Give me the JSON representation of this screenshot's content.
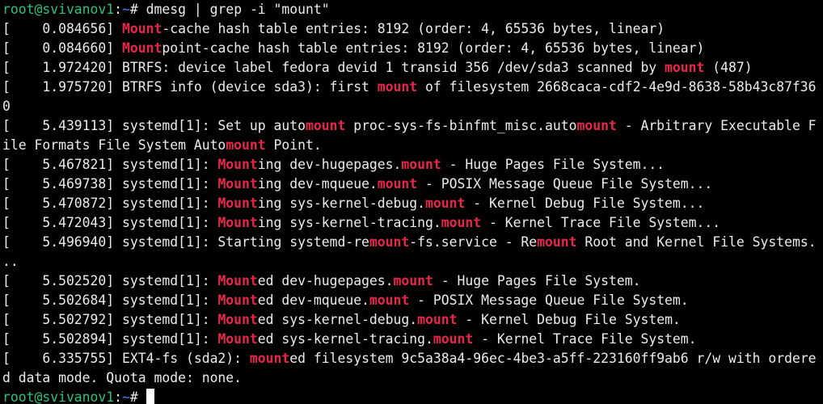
{
  "prompt": {
    "user_host": "root@svivanov1",
    "colon": ":",
    "path": "~",
    "symbol": "# "
  },
  "command": "dmesg | grep -i \"mount\"",
  "colors": {
    "background": "#000000",
    "text": "#ececec",
    "match_highlight": "#e8264a",
    "prompt_user": "#2ec27e",
    "prompt_path": "#3f83e8"
  },
  "highlight_term": "mount",
  "output_lines": [
    [
      [
        "t",
        "[    0.084656] "
      ],
      [
        "h",
        "Mount"
      ],
      [
        "t",
        "-cache hash table entries: 8192 (order: 4, 65536 bytes, linear)"
      ]
    ],
    [
      [
        "t",
        "[    0.084660] "
      ],
      [
        "h",
        "Mount"
      ],
      [
        "t",
        "point-cache hash table entries: 8192 (order: 4, 65536 bytes, linear)"
      ]
    ],
    [
      [
        "t",
        "[    1.972420] BTRFS: device label fedora devid 1 transid 356 /dev/sda3 scanned by "
      ],
      [
        "h",
        "mount"
      ],
      [
        "t",
        " (487)"
      ]
    ],
    [
      [
        "t",
        "[    1.975720] BTRFS info (device sda3): first "
      ],
      [
        "h",
        "mount"
      ],
      [
        "t",
        " of filesystem 2668caca-cdf2-4e9d-8638-58b43c87f36"
      ]
    ],
    [
      [
        "t",
        "0"
      ]
    ],
    [
      [
        "t",
        "[    5.439113] systemd[1]: Set up auto"
      ],
      [
        "h",
        "mount"
      ],
      [
        "t",
        " proc-sys-fs-binfmt_misc.auto"
      ],
      [
        "h",
        "mount"
      ],
      [
        "t",
        " - Arbitrary Executable F"
      ]
    ],
    [
      [
        "t",
        "ile Formats File System Auto"
      ],
      [
        "h",
        "mount"
      ],
      [
        "t",
        " Point."
      ]
    ],
    [
      [
        "t",
        "[    5.467821] systemd[1]: "
      ],
      [
        "h",
        "Mount"
      ],
      [
        "t",
        "ing dev-hugepages."
      ],
      [
        "h",
        "mount"
      ],
      [
        "t",
        " - Huge Pages File System..."
      ]
    ],
    [
      [
        "t",
        "[    5.469738] systemd[1]: "
      ],
      [
        "h",
        "Mount"
      ],
      [
        "t",
        "ing dev-mqueue."
      ],
      [
        "h",
        "mount"
      ],
      [
        "t",
        " - POSIX Message Queue File System..."
      ]
    ],
    [
      [
        "t",
        "[    5.470872] systemd[1]: "
      ],
      [
        "h",
        "Mount"
      ],
      [
        "t",
        "ing sys-kernel-debug."
      ],
      [
        "h",
        "mount"
      ],
      [
        "t",
        " - Kernel Debug File System..."
      ]
    ],
    [
      [
        "t",
        "[    5.472043] systemd[1]: "
      ],
      [
        "h",
        "Mount"
      ],
      [
        "t",
        "ing sys-kernel-tracing."
      ],
      [
        "h",
        "mount"
      ],
      [
        "t",
        " - Kernel Trace File System..."
      ]
    ],
    [
      [
        "t",
        "[    5.496940] systemd[1]: Starting systemd-re"
      ],
      [
        "h",
        "mount"
      ],
      [
        "t",
        "-fs.service - Re"
      ],
      [
        "h",
        "mount"
      ],
      [
        "t",
        " Root and Kernel File Systems."
      ]
    ],
    [
      [
        "t",
        ".."
      ]
    ],
    [
      [
        "t",
        "[    5.502520] systemd[1]: "
      ],
      [
        "h",
        "Mount"
      ],
      [
        "t",
        "ed dev-hugepages."
      ],
      [
        "h",
        "mount"
      ],
      [
        "t",
        " - Huge Pages File System."
      ]
    ],
    [
      [
        "t",
        "[    5.502684] systemd[1]: "
      ],
      [
        "h",
        "Mount"
      ],
      [
        "t",
        "ed dev-mqueue."
      ],
      [
        "h",
        "mount"
      ],
      [
        "t",
        " - POSIX Message Queue File System."
      ]
    ],
    [
      [
        "t",
        "[    5.502792] systemd[1]: "
      ],
      [
        "h",
        "Mount"
      ],
      [
        "t",
        "ed sys-kernel-debug."
      ],
      [
        "h",
        "mount"
      ],
      [
        "t",
        " - Kernel Debug File System."
      ]
    ],
    [
      [
        "t",
        "[    5.502894] systemd[1]: "
      ],
      [
        "h",
        "Mount"
      ],
      [
        "t",
        "ed sys-kernel-tracing."
      ],
      [
        "h",
        "mount"
      ],
      [
        "t",
        " - Kernel Trace File System."
      ]
    ],
    [
      [
        "t",
        "[    6.335755] EXT4-fs (sda2): "
      ],
      [
        "h",
        "mount"
      ],
      [
        "t",
        "ed filesystem 9c5a38a4-96ec-4be3-a5ff-223160ff9ab6 r/w with ordere"
      ]
    ],
    [
      [
        "t",
        "d data mode. Quota mode: none."
      ]
    ]
  ]
}
